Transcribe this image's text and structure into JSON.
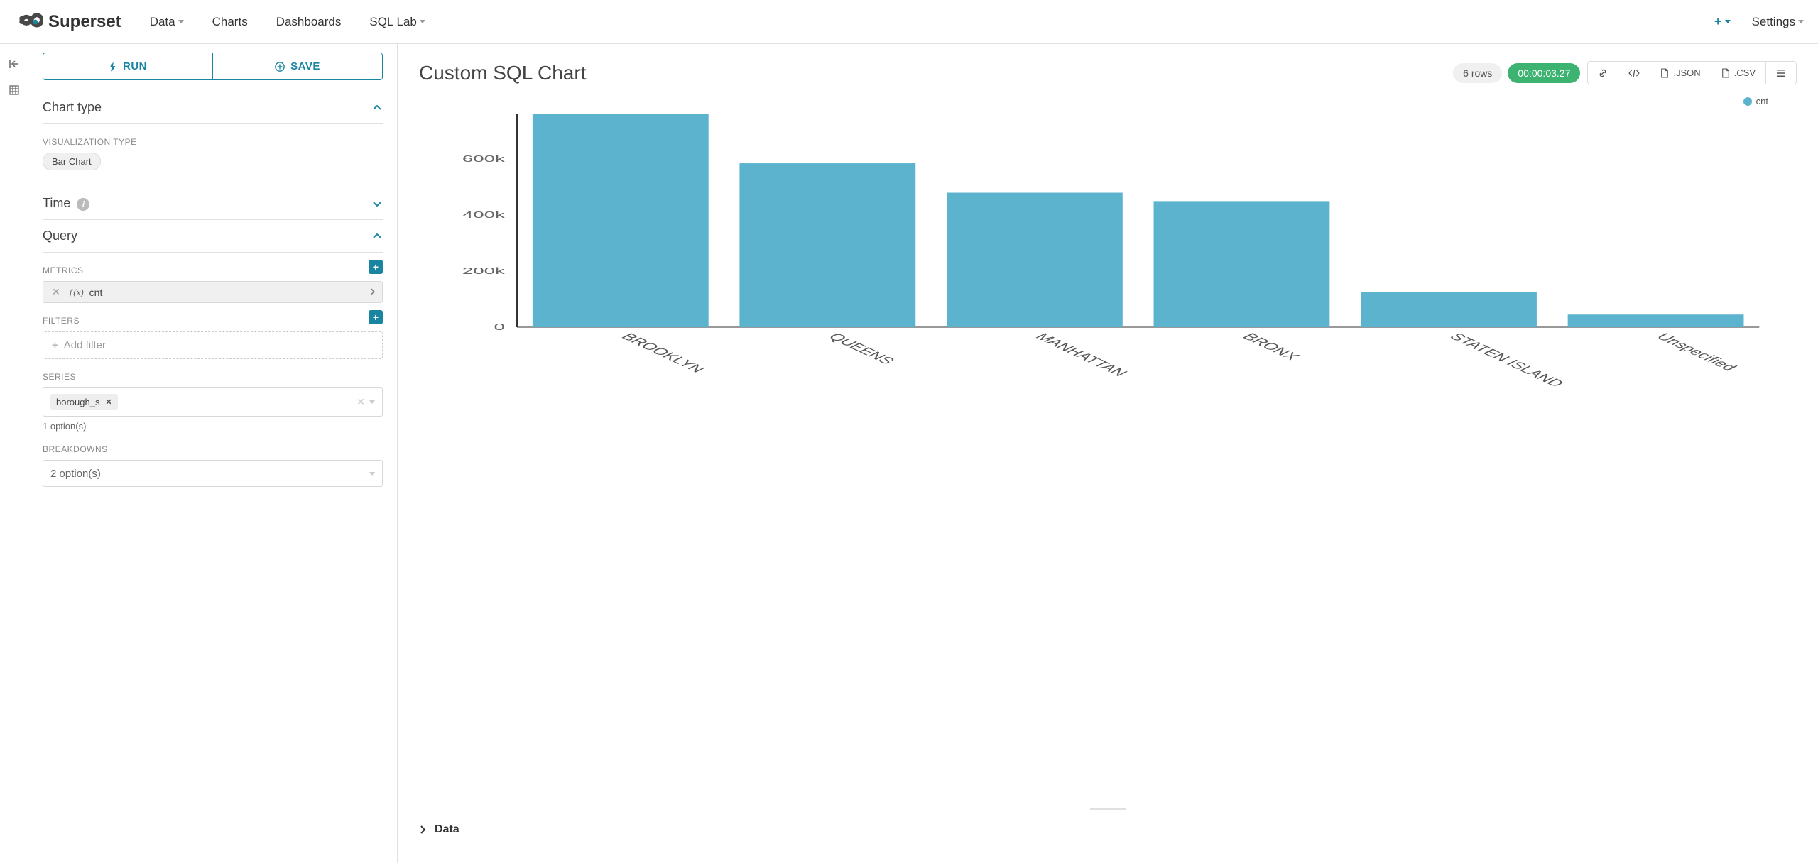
{
  "brand": "Superset",
  "nav": {
    "data": "Data",
    "charts": "Charts",
    "dashboards": "Dashboards",
    "sqllab": "SQL Lab",
    "settings": "Settings"
  },
  "buttons": {
    "run": "RUN",
    "save": "SAVE"
  },
  "sections": {
    "chart_type": "Chart type",
    "time": "Time",
    "query": "Query"
  },
  "viz_type": {
    "label": "VISUALIZATION TYPE",
    "value": "Bar Chart"
  },
  "query_fields": {
    "metrics_label": "METRICS",
    "metric_prefix": "ƒ(x)",
    "metric_value": "cnt",
    "filters_label": "FILTERS",
    "add_filter": "Add filter",
    "series_label": "SERIES",
    "series_tag": "borough_s",
    "series_count": "1 option(s)",
    "breakdowns_label": "BREAKDOWNS",
    "breakdowns_placeholder": "2 option(s)"
  },
  "chart": {
    "title": "Custom SQL Chart",
    "rowcount": "6 rows",
    "timer": "00:00:03.27",
    "json_btn": ".JSON",
    "csv_btn": ".CSV",
    "legend_series": "cnt",
    "data_section": "Data"
  },
  "chart_data": {
    "type": "bar",
    "categories": [
      "BROOKLYN",
      "QUEENS",
      "MANHATTAN",
      "BRONX",
      "STATEN ISLAND",
      "Unspecified"
    ],
    "values": [
      760000,
      585000,
      480000,
      450000,
      125000,
      45000
    ],
    "series": [
      {
        "name": "cnt",
        "values": [
          760000,
          585000,
          480000,
          450000,
          125000,
          45000
        ]
      }
    ],
    "title": "Custom SQL Chart",
    "xlabel": "",
    "ylabel": "",
    "ylim": [
      0,
      760000
    ],
    "yticks": [
      0,
      200000,
      400000,
      600000
    ],
    "ytick_labels": [
      "0",
      "200k",
      "400k",
      "600k"
    ]
  }
}
